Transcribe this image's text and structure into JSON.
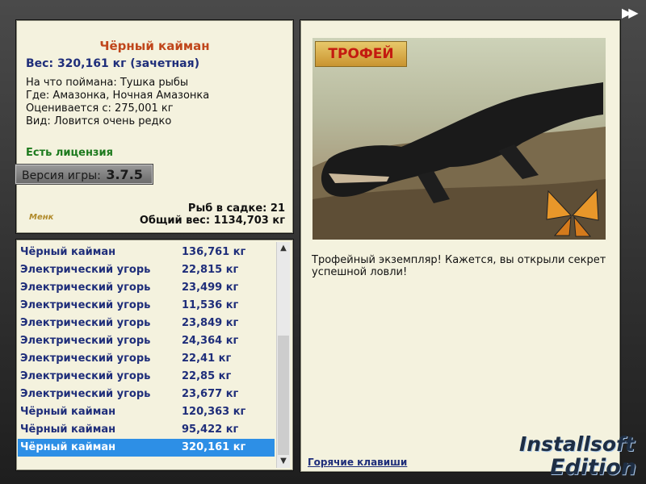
{
  "fish": {
    "name": "Чёрный кайман",
    "weight_line": "Вес: 320,161 кг (зачетная)",
    "bait": "На что поймана: Тушка рыбы",
    "location": "Где: Амазонка, Ночная Амазонка",
    "rated_from": "Оценивается с: 275,001 кг",
    "rarity": "Вид: Ловится очень редко"
  },
  "license": "Есть лицензия",
  "version": {
    "label": "Версия игры:",
    "value": "3.7.5"
  },
  "stats": {
    "count": "Рыб в садке: 21",
    "total": "Общий вес: 1134,703 кг"
  },
  "small_logo": "Менк",
  "catches": [
    {
      "name": "Чёрный кайман",
      "weight": "136,761 кг"
    },
    {
      "name": "Электрический угорь",
      "weight": "22,815 кг"
    },
    {
      "name": "Электрический угорь",
      "weight": "23,499 кг"
    },
    {
      "name": "Электрический угорь",
      "weight": "11,536 кг"
    },
    {
      "name": "Электрический угорь",
      "weight": "23,849 кг"
    },
    {
      "name": "Электрический угорь",
      "weight": "24,364 кг"
    },
    {
      "name": "Электрический угорь",
      "weight": "22,41 кг"
    },
    {
      "name": "Электрический угорь",
      "weight": "22,85 кг"
    },
    {
      "name": "Электрический угорь",
      "weight": "23,677 кг"
    },
    {
      "name": "Чёрный кайман",
      "weight": "120,363 кг"
    },
    {
      "name": "Чёрный кайман",
      "weight": "95,422 кг"
    },
    {
      "name": "Чёрный кайман",
      "weight": "320,161 кг",
      "selected": true
    }
  ],
  "trophy_badge": "ТРОФЕЙ",
  "description": "Трофейный экземпляр! Кажется, вы открыли секрет успешной ловли!",
  "hotkeys_link": "Горячие клавиши",
  "brand": {
    "line1": "Installsoft",
    "line2": "Edition"
  },
  "icons": {
    "forward": "fast-forward-icon",
    "scroll_up": "chevron-up-icon",
    "scroll_down": "chevron-down-icon"
  }
}
